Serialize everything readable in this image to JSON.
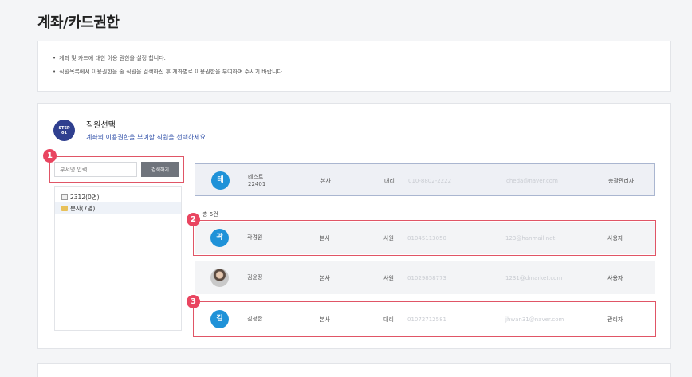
{
  "page": {
    "title": "계좌/카드권한"
  },
  "notice": {
    "lines": [
      "계좌 및 카드에 대한 이용 권한을 설정 합니다.",
      "직원목록에서 이용권한을 줄 직원을 검색하신 후 계좌별로 이용권한을 부여하며 주시기 바랍니다."
    ]
  },
  "step": {
    "badge_top": "STEP",
    "badge_num": "01",
    "title": "직원선택",
    "desc": "계좌의 이용권한을 부여할 직원을 선택하세요."
  },
  "markers": [
    "1",
    "2",
    "3"
  ],
  "search": {
    "placeholder": "부서명 입력",
    "button": "검색하기"
  },
  "tree": [
    {
      "label": "2312(0명)",
      "icon": "document-icon"
    },
    {
      "label": "본사(7명)",
      "icon": "folder-icon"
    }
  ],
  "count_label": "총 6건",
  "employees": [
    {
      "avatar": "테",
      "name": "테스트",
      "sub": "22401",
      "dept": "본사",
      "rank": "대리",
      "phone": "010-8802-2222",
      "email": "cheda@naver.com",
      "role": "총괄관리자"
    },
    {
      "avatar": "곽",
      "name": "곽경원",
      "sub": "",
      "dept": "본사",
      "rank": "사원",
      "phone": "01045113050",
      "email": "123@hanmail.net",
      "role": "사용자"
    },
    {
      "avatar": "",
      "name": "김윤정",
      "sub": "",
      "dept": "본사",
      "rank": "사원",
      "phone": "01029858773",
      "email": "1231@dmarket.com",
      "role": "사용자"
    },
    {
      "avatar": "김",
      "name": "김정한",
      "sub": "",
      "dept": "본사",
      "rank": "대리",
      "phone": "01072712581",
      "email": "jhwan31@naver.com",
      "role": "관리자"
    }
  ],
  "colors": {
    "accent": "#2f3f8f",
    "avatar": "#1f92d8",
    "marker": "#e94560"
  }
}
